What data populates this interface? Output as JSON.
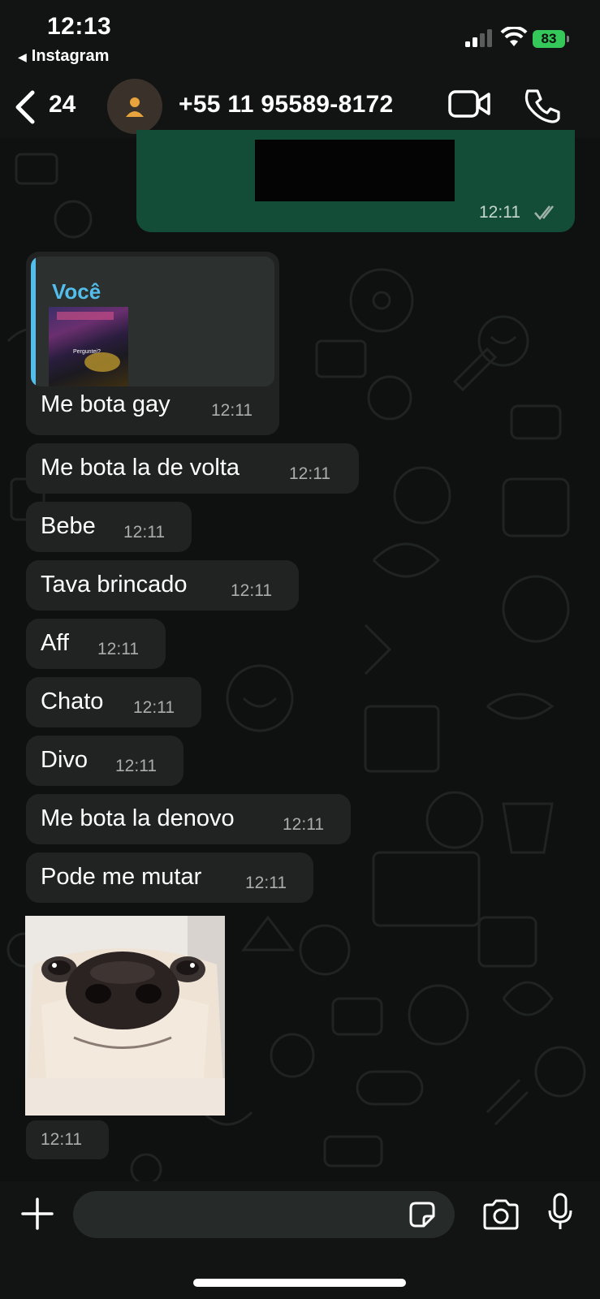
{
  "status_bar": {
    "time": "12:13",
    "back_app_label": "Instagram",
    "battery": "83"
  },
  "header": {
    "unread_count": "24",
    "contact_name": "+55 11 95589-8172"
  },
  "outgoing_top": {
    "time": "12:11"
  },
  "quoted_message": {
    "author": "Você",
    "thumbnail_caption": "Perguntei?",
    "text": "Me bota gay",
    "time": "12:11"
  },
  "messages": [
    {
      "text": "Me bota la de volta",
      "time": "12:11"
    },
    {
      "text": "Bebe",
      "time": "12:11"
    },
    {
      "text": "Tava brincado",
      "time": "12:11"
    },
    {
      "text": "Aff",
      "time": "12:11"
    },
    {
      "text": "Chato",
      "time": "12:11"
    },
    {
      "text": "Divo",
      "time": "12:11"
    },
    {
      "text": "Me bota la denovo",
      "time": "12:11"
    },
    {
      "text": "Pode me mutar",
      "time": "12:11"
    }
  ],
  "image_message": {
    "time": "12:11"
  },
  "composer": {
    "value": ""
  },
  "colors": {
    "outgoing_bubble": "#134d37",
    "incoming_bubble": "#202322",
    "quote_accent": "#53bdeb",
    "battery": "#34c759"
  }
}
